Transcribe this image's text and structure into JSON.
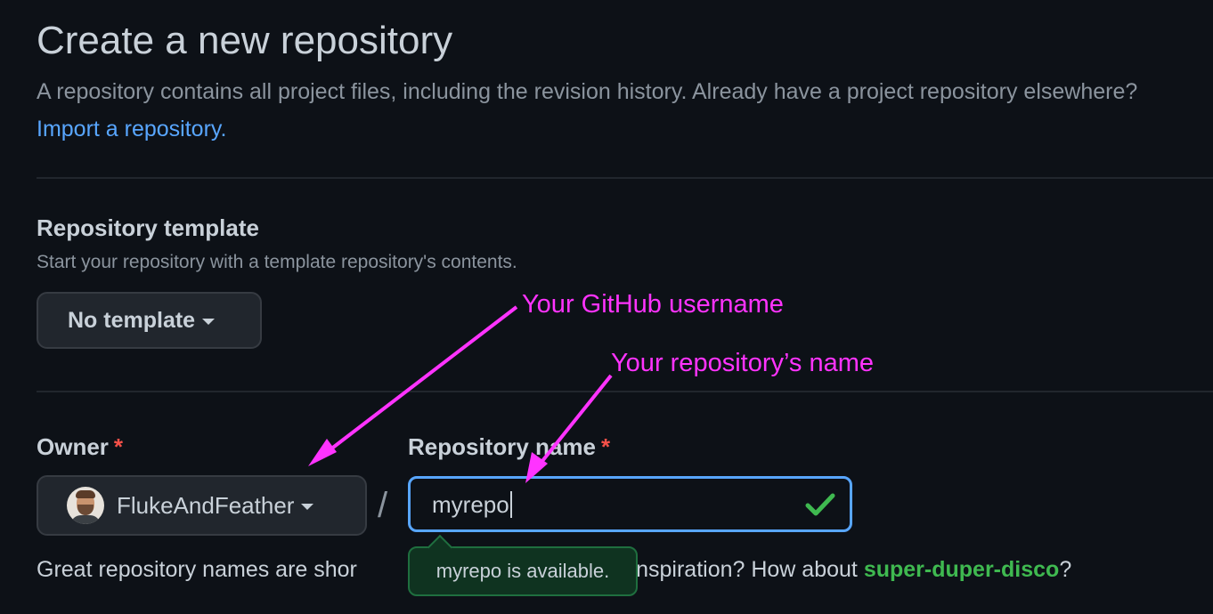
{
  "header": {
    "title": "Create a new repository",
    "subtitle": "A repository contains all project files, including the revision history. Already have a project repository elsewhere?",
    "import_link": "Import a repository."
  },
  "template_section": {
    "heading": "Repository template",
    "description": "Start your repository with a template repository's contents.",
    "dropdown_label": "No template"
  },
  "owner": {
    "label": "Owner",
    "required_mark": "*",
    "value": "FlukeAndFeather"
  },
  "separator": "/",
  "repo_name": {
    "label": "Repository name",
    "required_mark": "*",
    "value": "myrepo",
    "status_icon": "check-icon",
    "availability_tooltip": "myrepo is available."
  },
  "hint": {
    "prefix": "Great repository names are shor",
    "middle": "eed inspiration? How about ",
    "suggestion": "super-duper-disco",
    "suffix": "?"
  },
  "annotations": {
    "username": "Your GitHub username",
    "repo_name": "Your repository’s name"
  },
  "colors": {
    "background": "#0d1117",
    "link": "#58a6ff",
    "success": "#3fb950",
    "required": "#f85149",
    "annotation": "#ff33ff",
    "focus_border": "#58a6ff"
  }
}
